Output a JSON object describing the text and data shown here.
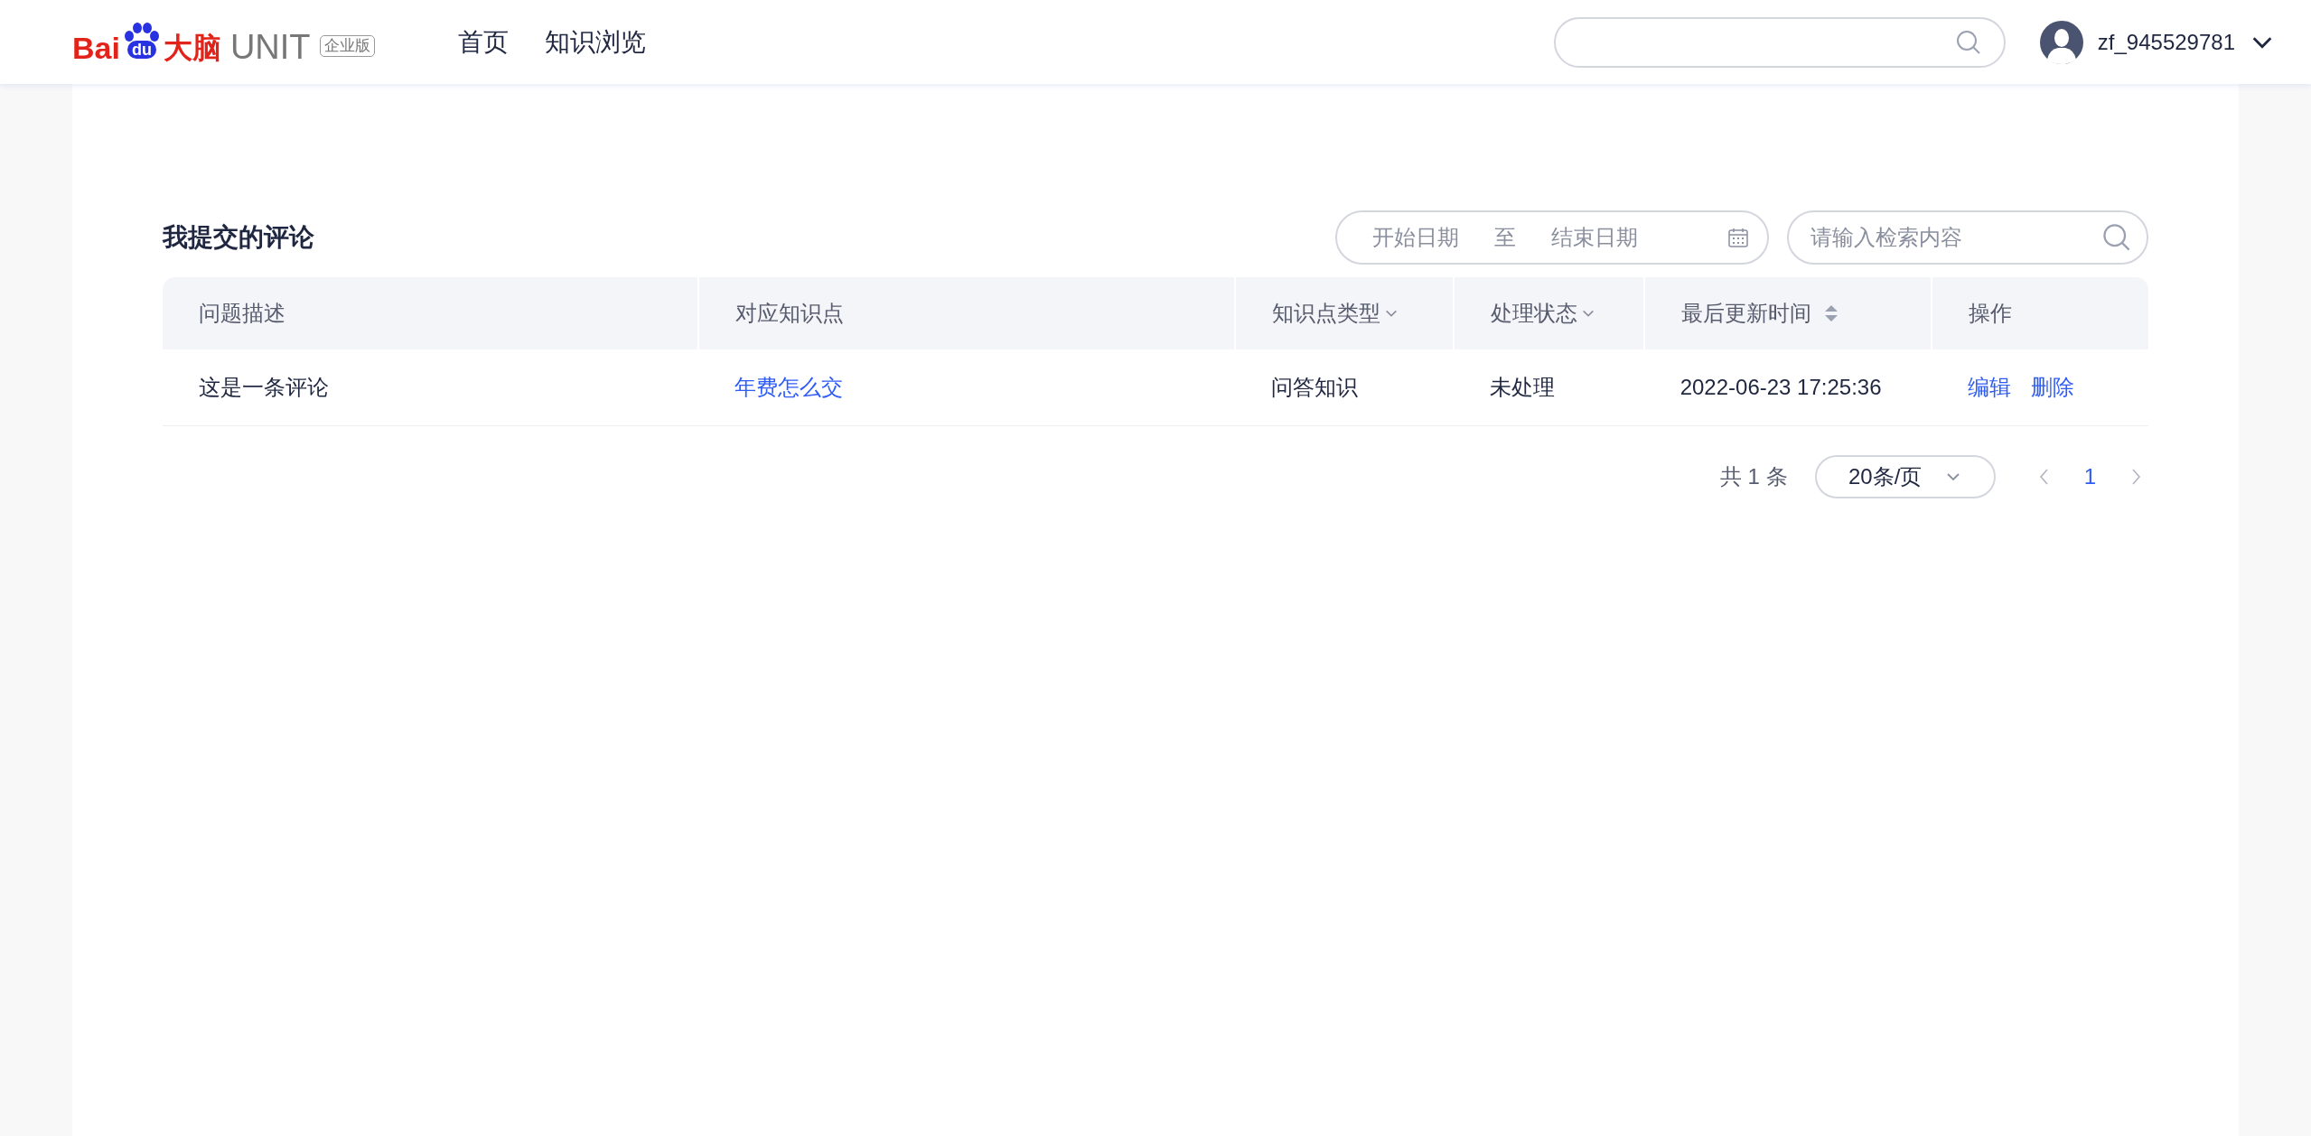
{
  "header": {
    "logo": {
      "brand_red": "Bai",
      "paw_text": "du",
      "brand_cn": "大脑",
      "product": "UNIT",
      "edition": "企业版"
    },
    "nav": [
      {
        "label": "首页",
        "selected": false
      },
      {
        "label": "知识浏览",
        "selected": false
      }
    ],
    "user": {
      "name": "zf_945529781"
    }
  },
  "page": {
    "title": "我提交的评论",
    "date_range": {
      "start_placeholder": "开始日期",
      "separator": "至",
      "end_placeholder": "结束日期"
    },
    "search": {
      "placeholder": "请输入检索内容"
    },
    "table": {
      "columns": [
        {
          "label": "问题描述",
          "kind": "plain"
        },
        {
          "label": "对应知识点",
          "kind": "plain"
        },
        {
          "label": "知识点类型",
          "kind": "filter"
        },
        {
          "label": "处理状态",
          "kind": "filter"
        },
        {
          "label": "最后更新时间",
          "kind": "sort"
        },
        {
          "label": "操作",
          "kind": "plain"
        }
      ],
      "rows": [
        {
          "cells": [
            {
              "kind": "text",
              "text": "这是一条评论"
            },
            {
              "kind": "link",
              "text": "年费怎么交"
            },
            {
              "kind": "text",
              "text": "问答知识"
            },
            {
              "kind": "text",
              "text": "未处理"
            },
            {
              "kind": "text",
              "text": "2022-06-23 17:25:36"
            },
            {
              "kind": "actions",
              "actions": [
                "编辑",
                "删除"
              ]
            }
          ]
        }
      ]
    },
    "pagination": {
      "total": "共 1 条",
      "page_size": "20条/页",
      "pages": [
        {
          "label": "1",
          "selected": true
        }
      ]
    }
  }
}
